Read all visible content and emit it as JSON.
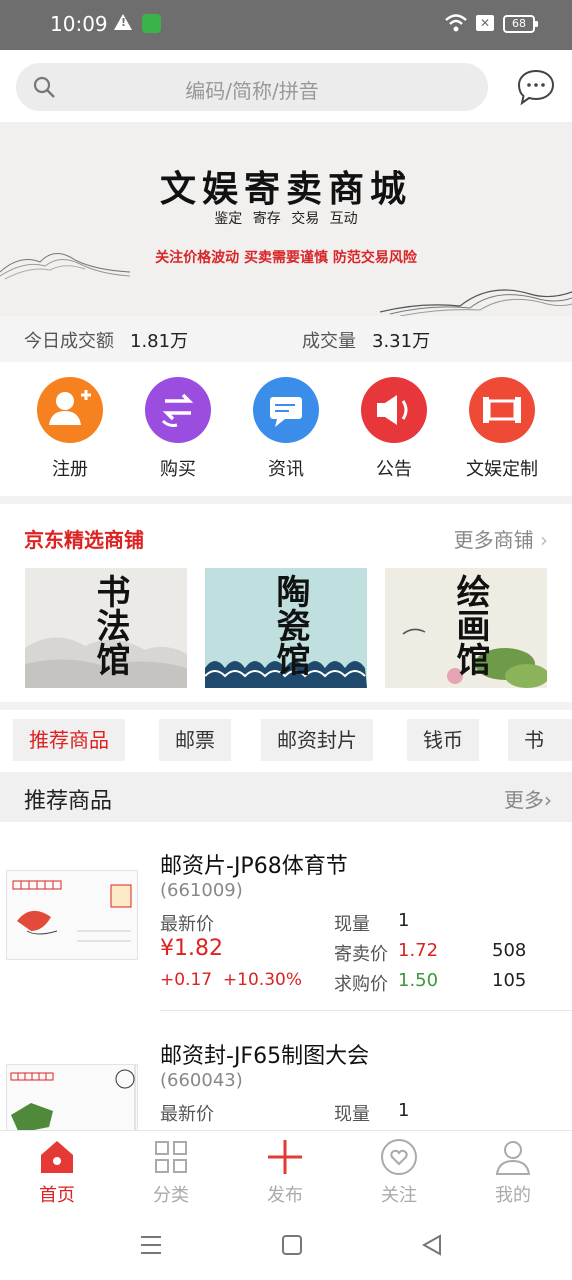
{
  "status_bar": {
    "time": "10:09",
    "battery": "68",
    "icons": [
      "warning-icon",
      "app-badge-icon",
      "wifi-icon",
      "no-sim-icon",
      "battery-icon"
    ]
  },
  "search": {
    "placeholder": "编码/简称/拼音"
  },
  "banner": {
    "title": "文娱寄卖商城",
    "subtitle": "鉴定 寄存 交易 互动",
    "warning": "关注价格波动 买卖需要谨慎 防范交易风险"
  },
  "stats": {
    "turnover_label": "今日成交额",
    "turnover_value": "1.81万",
    "volume_label": "成交量",
    "volume_value": "3.31万"
  },
  "quick_actions": [
    {
      "label": "注册",
      "icon": "register-user-icon",
      "color": "#f5811f"
    },
    {
      "label": "购买",
      "icon": "buy-exchange-icon",
      "color": "#9b4de0"
    },
    {
      "label": "资讯",
      "icon": "news-chat-icon",
      "color": "#3a8de8"
    },
    {
      "label": "公告",
      "icon": "announcement-speaker-icon",
      "color": "#e8373a"
    },
    {
      "label": "文娱定制",
      "icon": "custom-scroll-icon",
      "color": "#ef4a35"
    }
  ],
  "shops": {
    "title": "京东精选商铺",
    "more": "更多商铺",
    "items": [
      {
        "name": "书法馆"
      },
      {
        "name": "陶瓷馆"
      },
      {
        "name": "绘画馆"
      }
    ]
  },
  "tabs": [
    "推荐商品",
    "邮票",
    "邮资封片",
    "钱币",
    "书法"
  ],
  "section": {
    "title": "推荐商品",
    "more": "更多"
  },
  "products": [
    {
      "name": "邮资片-JP68体育节",
      "code": "(661009)",
      "latest_label": "最新价",
      "price": "¥1.82",
      "change": "+0.17",
      "change_pct": "+10.30%",
      "spot_label": "现量",
      "spot_value": "1",
      "ask_label": "寄卖价",
      "ask_price": "1.72",
      "ask_qty": "508",
      "bid_label": "求购价",
      "bid_price": "1.50",
      "bid_qty": "105"
    },
    {
      "name": "邮资封-JF65制图大会",
      "code": "(660043)",
      "latest_label": "最新价",
      "spot_label": "现量",
      "spot_value": "1"
    }
  ],
  "bottom_nav": [
    {
      "label": "首页",
      "icon": "home-icon",
      "active": true
    },
    {
      "label": "分类",
      "icon": "category-grid-icon",
      "active": false
    },
    {
      "label": "发布",
      "icon": "publish-plus-icon",
      "active": false
    },
    {
      "label": "关注",
      "icon": "follow-heart-icon",
      "active": false
    },
    {
      "label": "我的",
      "icon": "profile-person-icon",
      "active": false
    }
  ],
  "colors": {
    "accent": "#dd2222",
    "green": "#3a9a3a"
  }
}
